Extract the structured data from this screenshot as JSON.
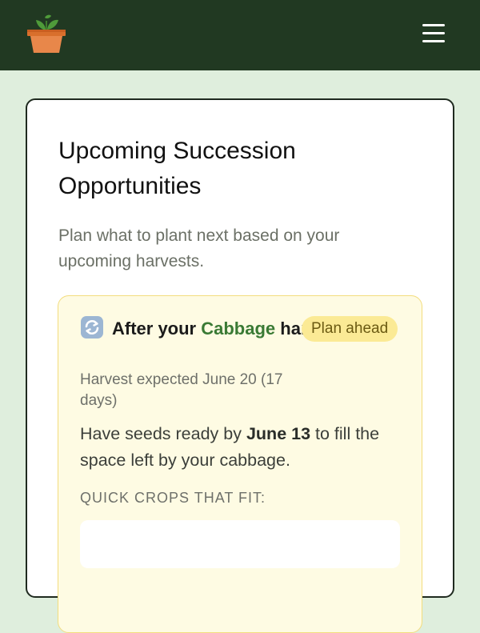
{
  "header": {
    "logo_icon": "potted-plant-icon",
    "menu_icon": "hamburger-menu-icon",
    "background": "#213922"
  },
  "card": {
    "title": "Upcoming Succession Opportunities",
    "subtitle": "Plan what to plant next based on your upcoming harvests."
  },
  "opportunity": {
    "icon": "cycle-arrows-icon",
    "heading_prefix": "After your",
    "crop": "Cabbage",
    "heading_suffix": "harvest",
    "badge": "Plan ahead",
    "harvest_note": "Harvest expected June 20 (17 days)",
    "seed_prefix": "Have seeds ready by",
    "seed_date": "June 13",
    "seed_suffix": "to fill the space left by your cabbage.",
    "quick_crops_label": "QUICK CROPS THAT FIT:"
  },
  "colors": {
    "page_background": "#dfeedd",
    "crop_accent": "#3a7a34",
    "badge_background": "#fbea95",
    "opportunity_background": "#fefbe3"
  }
}
